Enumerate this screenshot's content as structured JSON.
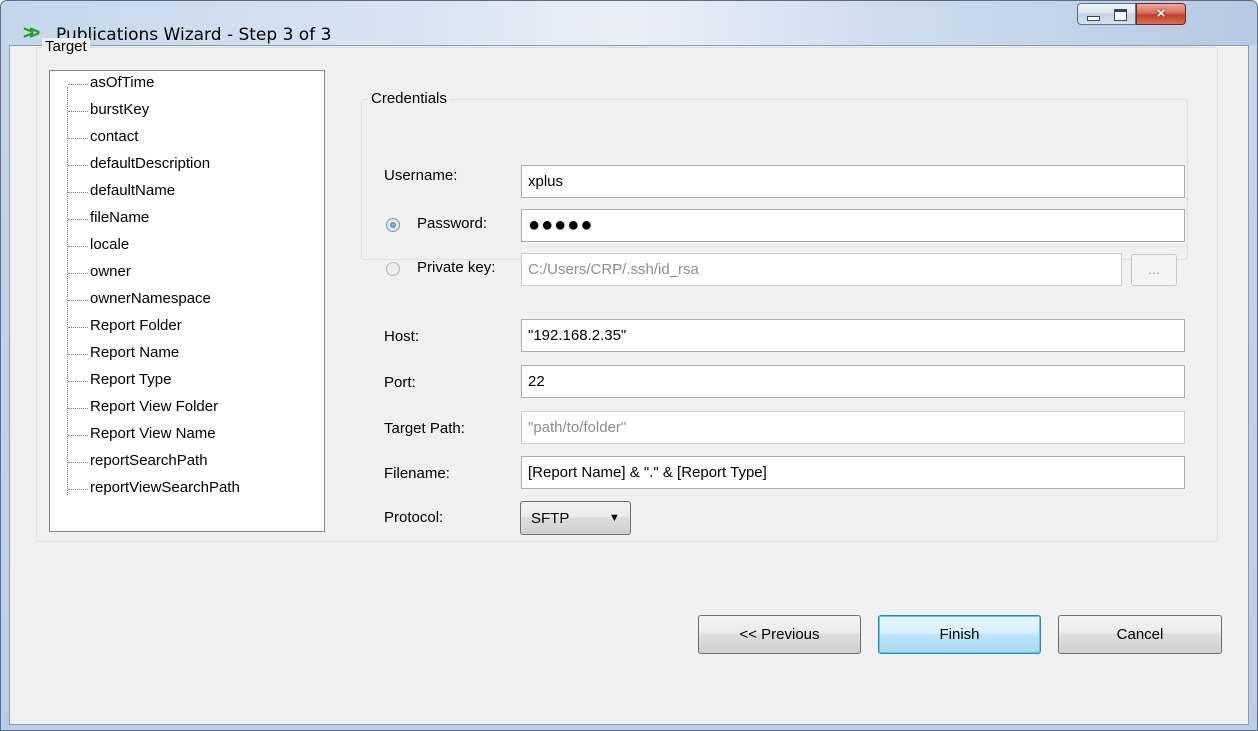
{
  "window": {
    "title": "Publications Wizard - Step 3 of 3",
    "app_icon": "chevrons-right-icon",
    "controls": {
      "minimize": "minimize-icon",
      "maximize": "maximize-icon",
      "close": "×"
    }
  },
  "target": {
    "label": "Target",
    "tree_items": [
      "asOfTime",
      "burstKey",
      "contact",
      "defaultDescription",
      "defaultName",
      "fileName",
      "locale",
      "owner",
      "ownerNamespace",
      "Report Folder",
      "Report Name",
      "Report Type",
      "Report View Folder",
      "Report View Name",
      "reportSearchPath",
      "reportViewSearchPath"
    ]
  },
  "credentials": {
    "label": "Credentials",
    "username_label": "Username:",
    "username_value": "xplus",
    "password_label": "Password:",
    "password_value": "●●●●●",
    "password_selected": true,
    "private_key_label": "Private key:",
    "private_key_value": "C:/Users/CRP/.ssh/id_rsa",
    "browse_label": "..."
  },
  "fields": {
    "host_label": "Host:",
    "host_value": "\"192.168.2.35\"",
    "port_label": "Port:",
    "port_value": "22",
    "target_path_label": "Target Path:",
    "target_path_value": "\"path/to/folder\"",
    "filename_label": "Filename:",
    "filename_value": "[Report Name] & \".\" & [Report Type]",
    "protocol_label": "Protocol:",
    "protocol_value": "SFTP",
    "protocol_arrow": "▼"
  },
  "buttons": {
    "previous": "<< Previous",
    "finish": "Finish",
    "cancel": "Cancel"
  },
  "colors": {
    "titlebar": "#c6d7ec",
    "close_button": "#c23e26",
    "app_icon": "#1f9c2a",
    "default_button": "#bee6fd"
  }
}
